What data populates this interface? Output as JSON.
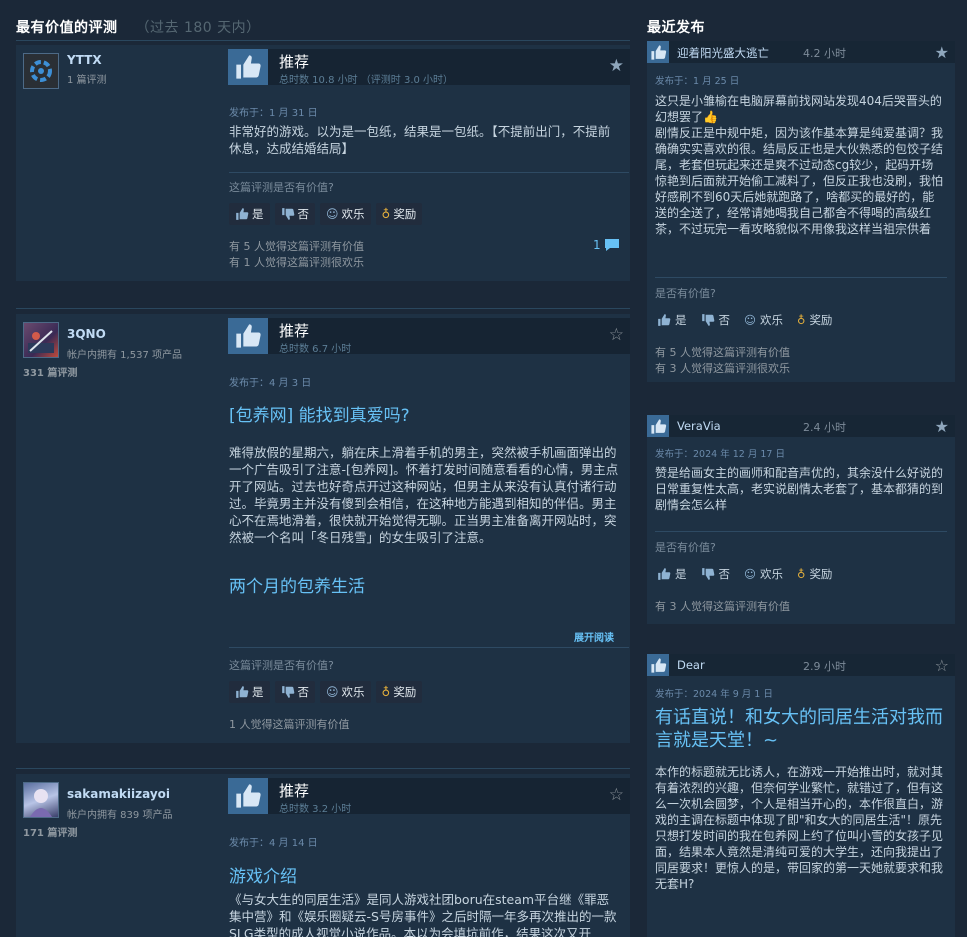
{
  "sections": {
    "helpful_title": "最有价值的评测",
    "helpful_period": "（过去 180 天内）",
    "recent_title": "最近发布"
  },
  "colors": {
    "background": "#1b2838",
    "accent": "#67c1f5",
    "thumb": "#3a6a96",
    "award": "#e5b03c"
  },
  "icons": {
    "thumbs_up": "thumbs-up-icon",
    "thumbs_down": "thumbs-down-icon",
    "funny": "smiley-icon",
    "award": "award-icon",
    "comment": "comment-icon",
    "star": "star-icon"
  },
  "buttons": {
    "yes": "是",
    "no": "否",
    "funny": "欢乐",
    "award": "奖励"
  },
  "helpful_question": "这篇评测是否有价值?",
  "recent_question": "是否有价值?",
  "expand_label": "展开阅读",
  "reviews": [
    {
      "author": "YTTX",
      "reviews_count": "1 篇评测",
      "verdict": "推荐",
      "hours": "总时数 10.8 小时  （评测时 3.0 小时）",
      "posted": "发布于：1 月 31 日",
      "text": "非常好的游戏。以为是一包纸，结果是一包纸。【不提前出门，不提前休息，达成结婚结局】",
      "helpful": "有 5 人觉得这篇评测有价值",
      "funny": "有 1 人觉得这篇评测很欢乐",
      "comments": "1"
    },
    {
      "author": "3QNO",
      "products": "帐户内拥有 1,537 项产品",
      "reviews_count": "331 篇评测",
      "verdict": "推荐",
      "hours": "总时数 6.7 小时",
      "posted": "发布于：4 月 3 日",
      "heading": "[包养网] 能找到真爱吗?",
      "text": "难得放假的星期六，躺在床上滑着手机的男主，突然被手机画面弹出的一个广告吸引了注意-[包养网]。怀着打发时间随意看看的心情，男主点开了网站。过去也好奇点开过这种网站，但男主从来没有认真付诸行动过。毕竟男主并没有傻到会相信，在这种地方能遇到相知的伴侣。男主心不在焉地滑着，很快就开始觉得无聊。正当男主准备离开网站时，突然被一个名叫「冬日残雪」的女生吸引了注意。",
      "heading2": "两个月的包养生活",
      "helpful": "1 人觉得这篇评测有价值"
    },
    {
      "author": "sakamakiizayoi",
      "products": "帐户内拥有 839 项产品",
      "reviews_count": "171 篇评测",
      "verdict": "推荐",
      "hours": "总时数 3.2 小时",
      "posted": "发布于：4 月 14 日",
      "heading": "游戏介绍",
      "text": "《与女大生的同居生活》是同人游戏社团boru在steam平台继《罪恶集中营》和《娱乐圈疑云-S号房事件》之后时隔一年多再次推出的一款SLG类型的成人视觉小说作品。本以为会填坑前作，结果这次又开"
    }
  ],
  "recent": [
    {
      "author": "迎着阳光盛大逃亡",
      "hours": "4.2 小时",
      "posted": "发布于：1 月 25 日",
      "text": "这只是小雏榆在电脑屏幕前找网站发现404后哭晋头的幻想罢了👍\n剧情反正是中规中矩，因为该作基本算是纯爱基调？我确确实实喜欢的很。结局反正也是大伙熟悉的包饺子结尾，老套但玩起来还是爽不过动态cg较少，起码开场惊艳到后面就开始偷工减料了，但反正我也没刷，我怕好感刷不到60天后她就跑路了，啥都买的最好的，能送的全送了，经常请她喝我自己都舍不得喝的高级红茶，不过玩完一看攻略貌似不用像我这样当祖宗供着",
      "helpful": "有 5 人觉得这篇评测有价值",
      "funny": "有 3 人觉得这篇评测很欢乐"
    },
    {
      "author": "VeraVia",
      "hours": "2.4 小时",
      "posted": "发布于：2024 年 12 月 17 日",
      "text": "赞是给画女主的画师和配音声优的，其余没什么好说的日常重复性太高，老实说剧情太老套了，基本都猜的到剧情会怎么样",
      "helpful": "有 3 人觉得这篇评测有价值"
    },
    {
      "author": "Dear",
      "hours": "2.9 小时",
      "posted": "发布于：2024 年 9 月 1 日",
      "heading": "有话直说！和女大的同居生活对我而言就是天堂！~",
      "text": "本作的标题就无比诱人，在游戏一开始推出时，就对其有着浓烈的兴趣，但奈何学业繁忙，就错过了，但有这么一次机会圆梦，个人是相当开心的，本作很直白，游戏的主调在标题中体现了即\"和女大的同居生活\"！原先只想打发时间的我在包养网上约了位叫小雪的女孩子见面，结果本人竟然是清纯可爱的大学生，还向我提出了同居要求！更惊人的是，带回家的第一天她就要求和我无套H?"
    }
  ]
}
